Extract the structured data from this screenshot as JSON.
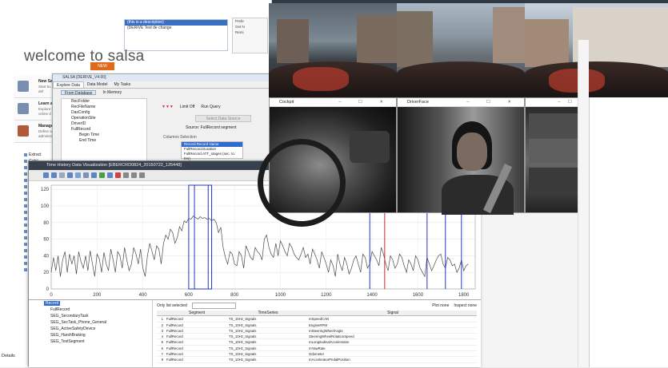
{
  "welcome": {
    "title": "welcome to salsa",
    "badge": "NEW",
    "top_list": [
      "(this is a description)",
      "(DERIVE Test de change"
    ],
    "side_panel": [
      "Prefe",
      "Get N",
      "Remi"
    ],
    "cards": [
      {
        "title": "New Sa",
        "sub": "Start bu and def"
      },
      {
        "title": "Learn al",
        "sub": "Explore t online d"
      },
      {
        "title": "Manage",
        "sub": "Define a administ"
      }
    ],
    "file_list": [
      "Extract",
      "Getsi",
      "GetTo",
      "TestC",
      "Install",
      "mpr-m",
      "Multip",
      "MyExt",
      "Petch",
      "Relea",
      "SALSI",
      "SALSE",
      "SALSE",
      "SALSE",
      "SALSE",
      "SALSE",
      "SALSE",
      "SALSE",
      "test-n"
    ],
    "details_label": "Details"
  },
  "explore": {
    "title": "SALSA [DERIVE_V4.00]",
    "tabs": [
      "Explore Data",
      "Data Model",
      "My Tasks"
    ],
    "mode_buttons": [
      "From Database",
      "In Memory"
    ],
    "tree": [
      "RecFolder",
      "RecFileName",
      "DasConfig",
      "OperationSite",
      "DriverID",
      "FullRecord",
      "Begin Time",
      "End Time"
    ],
    "toolbar": [
      "Limit Off",
      "Run Query"
    ],
    "select_source": "Select Data Source",
    "source_label": "Source: FullRecord segment",
    "columns_label": "Columns Selection",
    "columns": [
      "Record.Record Name",
      "FullRecord.Duration",
      "FullRecord.ATT_stages (sec. to. hrs)"
    ]
  },
  "time_history": {
    "title": "Time History Data Visualization [EBERCRD0824_20150722_125448]",
    "tree": [
      {
        "label": "Record",
        "selected": true
      },
      {
        "label": "FullRecord",
        "selected": false
      },
      {
        "label": "SEG_SecondaryTask",
        "selected": false
      },
      {
        "label": "SEG_SecTask_Phone_General",
        "selected": false
      },
      {
        "label": "SEG_ActiveSafetyDevice",
        "selected": false
      },
      {
        "label": "SEG_HarshBraking",
        "selected": false
      },
      {
        "label": "SEG_TestSegment",
        "selected": false
      }
    ],
    "table_tools": {
      "only_list": "Only list selected",
      "plot_none": "Plot none",
      "inspect_none": "Inspect none"
    },
    "table_headers": [
      "",
      "Segment",
      "TimeSeries",
      "Signal"
    ],
    "table_rows": [
      [
        "1",
        "FullRecord",
        "TS_10Hz_Signals",
        "mSpeedCAN"
      ],
      [
        "2",
        "FullRecord",
        "TS_10Hz_Signals",
        "EngineRPM"
      ],
      [
        "3",
        "FullRecord",
        "TS_10Hz_Signals",
        "mSteeringWheelAngle"
      ],
      [
        "4",
        "FullRecord",
        "TS_10Hz_Signals",
        "SteeringWheelRotationSpeed"
      ],
      [
        "5",
        "FullRecord",
        "TS_10Hz_Signals",
        "mLongitudinalAcceleration"
      ],
      [
        "6",
        "FullRecord",
        "TS_10Hz_Signals",
        "mYawRate"
      ],
      [
        "7",
        "FullRecord",
        "TS_10Hz_Signals",
        "Odometer"
      ],
      [
        "8",
        "FullRecord",
        "TS_10Hz_Signals",
        "mAcceleratorPedalPosition"
      ]
    ]
  },
  "video_windows": {
    "cockpit": "Cockpit",
    "driverface": "DriverFace",
    "controls": "– ☐ ✕"
  },
  "colors": {
    "title_bar": "#37414d",
    "series": "#4a4a4a",
    "marker_blue": "#2233cc",
    "marker_red": "#cc2233",
    "selection": "#2f6ad1"
  },
  "chart_data": {
    "type": "line",
    "title": "",
    "xlabel": "",
    "ylabel": "",
    "xlim": [
      0,
      1850
    ],
    "ylim": [
      0,
      125
    ],
    "xticks": [
      0,
      200,
      400,
      600,
      800,
      1000,
      1200,
      1400,
      1600,
      1800
    ],
    "yticks": [
      0,
      20,
      40,
      60,
      80,
      100,
      120
    ],
    "series": [
      {
        "x": [
          0,
          10,
          20,
          30,
          40,
          50,
          60,
          70,
          80,
          90,
          100,
          110,
          120,
          130,
          140,
          150,
          160,
          170,
          180,
          190,
          200,
          210,
          220,
          230,
          240,
          250,
          260,
          270,
          280,
          290,
          300,
          310,
          320,
          330,
          340,
          350,
          360,
          370,
          380,
          390,
          400,
          410,
          420,
          430,
          440,
          450,
          460,
          470,
          480,
          490,
          500,
          510,
          520,
          530,
          540,
          550,
          560,
          570,
          580,
          590,
          600,
          610,
          620,
          630,
          640,
          650,
          660,
          670,
          680,
          690,
          700,
          710,
          720,
          730,
          740,
          750,
          760,
          770,
          780,
          790,
          800,
          810,
          820,
          830,
          840,
          850,
          860,
          870,
          880,
          890,
          900,
          910,
          920,
          930,
          940,
          950,
          960,
          970,
          980,
          990,
          1000,
          1010,
          1020,
          1030,
          1040,
          1050,
          1060,
          1070,
          1080,
          1090,
          1100,
          1110,
          1120,
          1130,
          1140,
          1150,
          1160,
          1170,
          1180,
          1190,
          1200,
          1210,
          1220,
          1230,
          1240,
          1250,
          1260,
          1270,
          1280,
          1290,
          1300,
          1310,
          1320,
          1330,
          1340,
          1350,
          1360,
          1370,
          1380,
          1390,
          1400,
          1410,
          1420,
          1430,
          1440,
          1450,
          1460,
          1470,
          1480,
          1490,
          1500,
          1510,
          1520,
          1530,
          1540,
          1550,
          1560,
          1570,
          1580,
          1590,
          1600,
          1610,
          1620,
          1630,
          1640,
          1650,
          1660,
          1670,
          1680,
          1690,
          1700,
          1710,
          1720,
          1730,
          1740,
          1750,
          1760,
          1770,
          1780,
          1790,
          1800,
          1810,
          1820
        ],
        "y": [
          20,
          38,
          22,
          40,
          15,
          35,
          45,
          20,
          42,
          30,
          40,
          18,
          45,
          33,
          25,
          40,
          22,
          46,
          30,
          15,
          42,
          36,
          20,
          44,
          30,
          22,
          48,
          35,
          20,
          45,
          40,
          25,
          50,
          35,
          22,
          30,
          50,
          42,
          30,
          48,
          25,
          15,
          40,
          55,
          45,
          35,
          52,
          48,
          30,
          55,
          65,
          60,
          72,
          68,
          55,
          62,
          75,
          70,
          82,
          80,
          85,
          84,
          88,
          86,
          84,
          87,
          85,
          86,
          84,
          85,
          82,
          84,
          80,
          68,
          74,
          50,
          38,
          30,
          45,
          42,
          30,
          28,
          45,
          40,
          25,
          52,
          45,
          38,
          35,
          50,
          45,
          42,
          35,
          60,
          65,
          50,
          42,
          38,
          55,
          40,
          58,
          52,
          45,
          40,
          55,
          50,
          42,
          38,
          35,
          42,
          50,
          38,
          42,
          30,
          48,
          42,
          35,
          25,
          45,
          38,
          30,
          20,
          35,
          28,
          15,
          42,
          30,
          22,
          38,
          30,
          18,
          25,
          35,
          40,
          30,
          20,
          42,
          38,
          25,
          30,
          45,
          40,
          35,
          28,
          50,
          42,
          30,
          22,
          40,
          35,
          25,
          30,
          42,
          38,
          28,
          20,
          35,
          30,
          22,
          40,
          35,
          25,
          20,
          15,
          38,
          30,
          22,
          28,
          35,
          40,
          42,
          30,
          25,
          38,
          35,
          28,
          30,
          20,
          25,
          35,
          22,
          28,
          30
        ]
      }
    ],
    "markers_blue": [
      625,
      685,
      1390,
      1640,
      1720,
      1790
    ],
    "markers_red": [
      1455
    ],
    "blue_box": [
      600,
      700
    ]
  }
}
